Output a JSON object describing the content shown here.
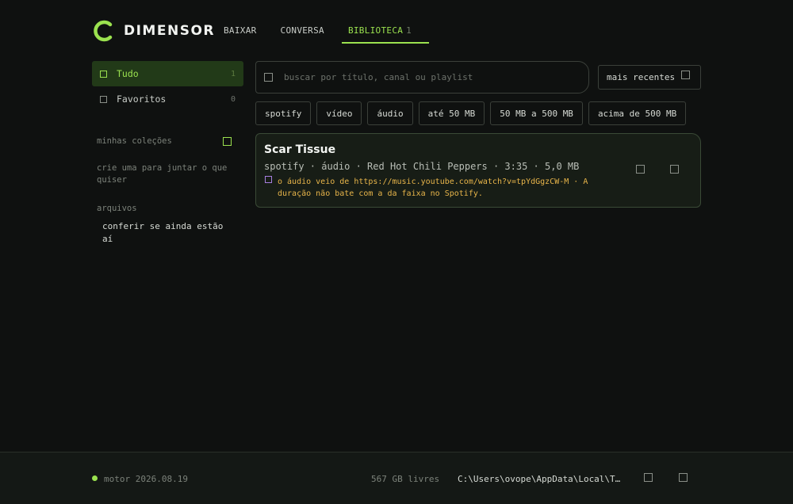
{
  "app": {
    "name": "DIMENSOR",
    "accent": "#9be24f"
  },
  "nav": {
    "items": [
      {
        "label": "BAIXAR"
      },
      {
        "label": "CONVERSA"
      },
      {
        "label": "BIBLIOTECA",
        "count": "1",
        "active": true
      }
    ]
  },
  "sidebar": {
    "items": [
      {
        "label": "Tudo",
        "count": "1",
        "active": true
      },
      {
        "label": "Favoritos",
        "count": "0"
      }
    ],
    "collections_heading": "minhas coleções",
    "collections_hint": "crie uma para juntar o que quiser",
    "files_heading": "arquivos",
    "files_link": "conferir se ainda estão aí"
  },
  "search": {
    "placeholder": "buscar por título, canal ou playlist",
    "value": ""
  },
  "sort": {
    "label": "mais recentes"
  },
  "filters": [
    "spotify",
    "vídeo",
    "áudio",
    "até 50 MB",
    "50 MB a 500 MB",
    "acima de 500 MB"
  ],
  "library": {
    "items": [
      {
        "title": "Scar Tissue",
        "meta": "spotify · áudio · Red Hot Chili Peppers · 3:35 · 5,0 MB",
        "warning": "o áudio veio de https://music.youtube.com/watch?v=tpYdGgzCW-M · A duração não bate com a da faixa no Spotify."
      }
    ]
  },
  "footer": {
    "status": "motor 2026.08.19",
    "free_space": "567 GB livres",
    "path": "C:\\Users\\ovope\\AppData\\Local\\T…"
  }
}
